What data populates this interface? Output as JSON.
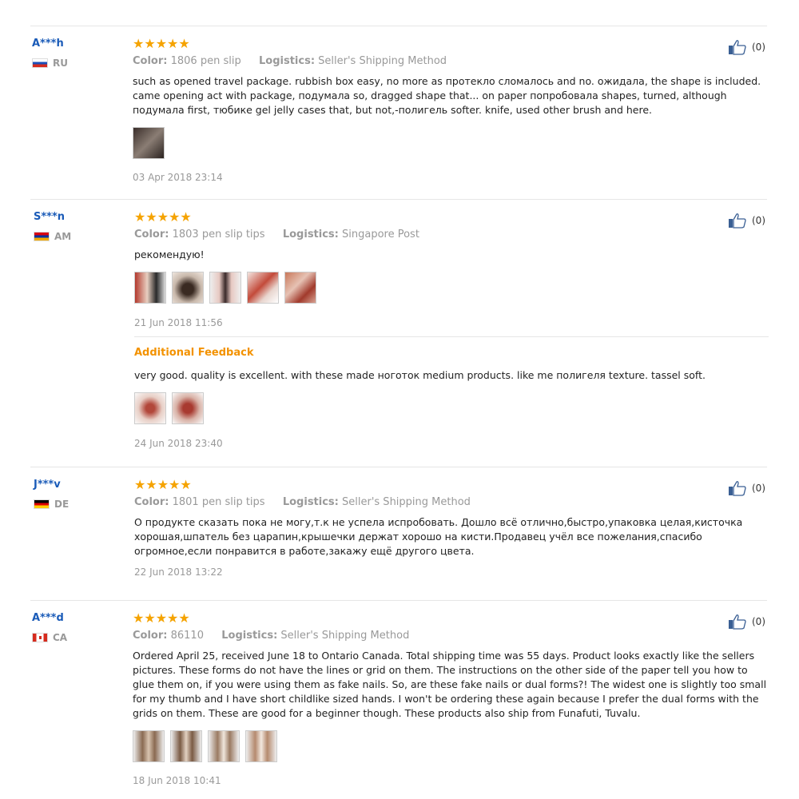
{
  "reviews": [
    {
      "user": "A***h",
      "country": "RU",
      "stars": "★★★★★",
      "color_label": "Color:",
      "color_value": "1806 pen slip",
      "logistics_label": "Logistics:",
      "logistics_value": "Seller's Shipping Method",
      "text": "such as opened travel package. rubbish box easy, no more as протекло сломалось and no. ожидала, the shape is included. came opening act with package, подумала so, dragged shape that... on paper попробовала shapes, turned, although подумала first, тюбике gel jelly cases that, but not,-полигель softer. knife, used other brush and here.",
      "date": "03 Apr 2018 23:14",
      "likes": "(0)"
    },
    {
      "user": "S***n",
      "country": "AM",
      "stars": "★★★★★",
      "color_label": "Color:",
      "color_value": "1803 pen slip tips",
      "logistics_label": "Logistics:",
      "logistics_value": "Singapore Post",
      "text": "рекомендую!",
      "date": "21 Jun 2018 11:56",
      "likes": "(0)",
      "additional": {
        "title": "Additional Feedback",
        "text": "very good. quality is excellent. with these made ноготок medium products. like me полигеля texture. tassel soft.",
        "date": "24 Jun 2018 23:40"
      }
    },
    {
      "user": "J***v",
      "country": "DE",
      "stars": "★★★★★",
      "color_label": "Color:",
      "color_value": "1801 pen slip tips",
      "logistics_label": "Logistics:",
      "logistics_value": "Seller's Shipping Method",
      "text": "О продукте сказать пока не могу,т.к не успела испробовать. Дошло всё отлично,быстро,упаковка целая,кисточка хорошая,шпатель без царапин,крышечки держат хорошо на кисти.Продавец учёл все пожелания,спасибо огромное,если понравится в работе,закажу ещё другого цвета.",
      "date": "22 Jun 2018 13:22",
      "likes": "(0)"
    },
    {
      "user": "A***d",
      "country": "CA",
      "stars": "★★★★★",
      "color_label": "Color:",
      "color_value": "86110",
      "logistics_label": "Logistics:",
      "logistics_value": "Seller's Shipping Method",
      "text": "Ordered April 25, received June 18 to Ontario Canada. Total shipping time was 55 days. Product looks exactly like the sellers pictures. These forms do not have the lines or grid on them. The instructions on the other side of the paper tell you how to glue them on, if you were using them as fake nails. So, are these fake nails or dual forms?! The widest one is slightly too small for my thumb and I have short childlike sized hands. I won't be ordering these again because I prefer the dual forms with the grids on them. These are good for a beginner though. These products also ship from Funafuti, Tuvalu.",
      "date": "18 Jun 2018 10:41",
      "likes": "(0)"
    }
  ],
  "icons": {
    "like": "thumbs-up-icon"
  },
  "colors": {
    "username": "#1a5bb8",
    "stars": "#f5a300",
    "additional": "#f39200",
    "muted": "#999999"
  }
}
